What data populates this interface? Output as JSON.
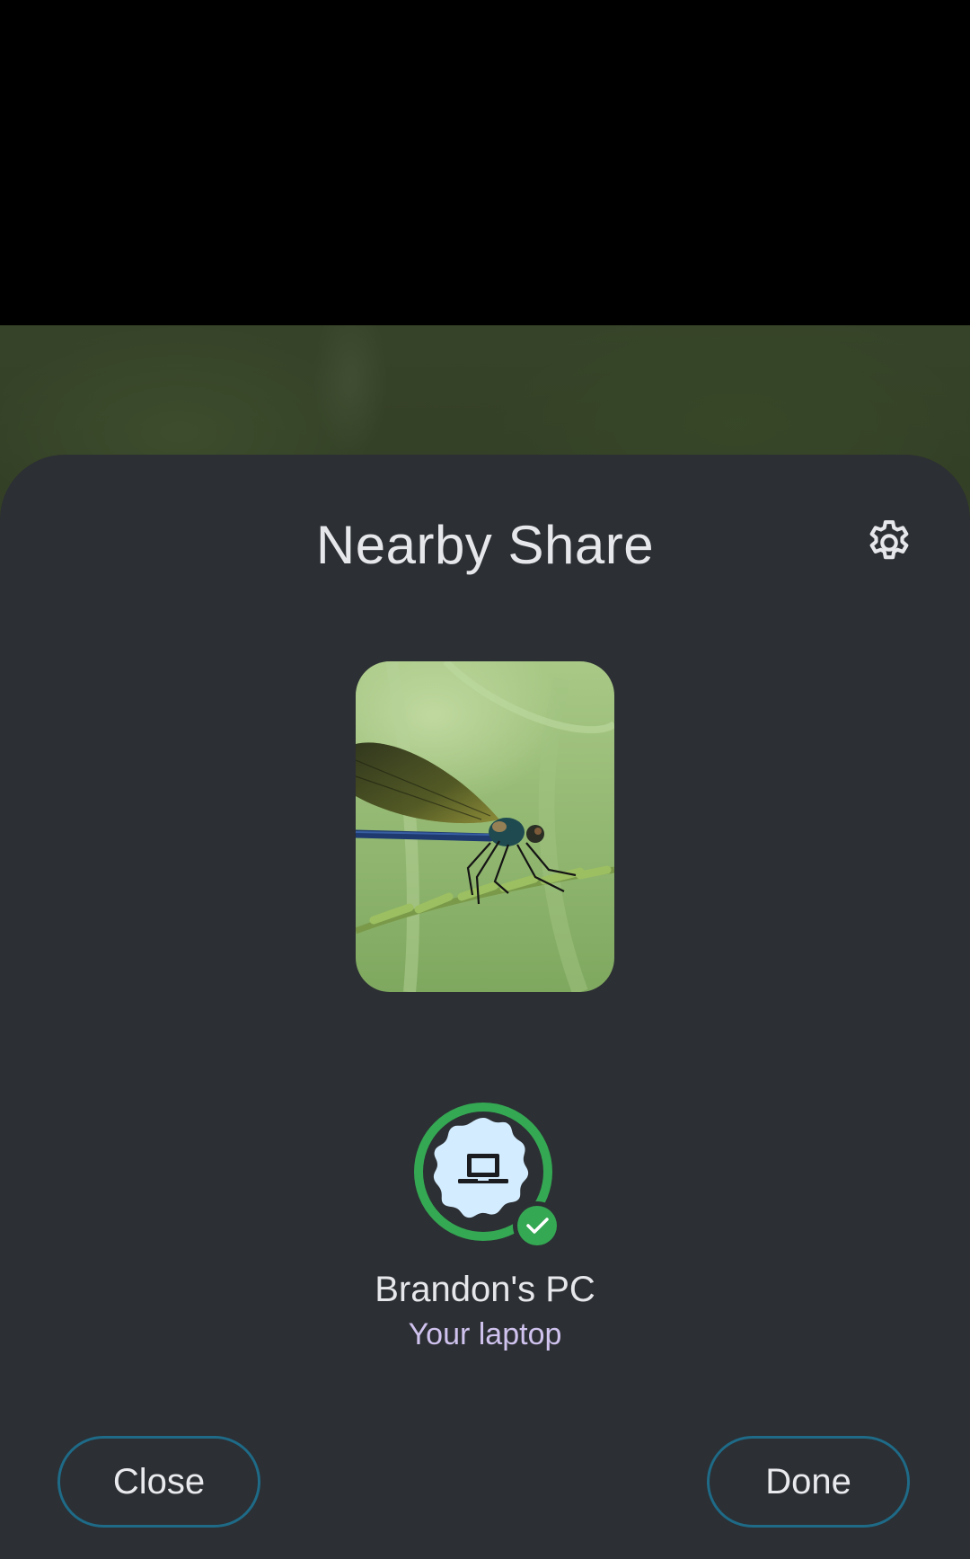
{
  "sheet": {
    "title": "Nearby Share",
    "settings_icon": "gear-icon"
  },
  "preview": {
    "subject": "dragonfly photo"
  },
  "device": {
    "name": "Brandon's PC",
    "subtitle": "Your laptop",
    "icon": "laptop-icon",
    "status_icon": "checkmark-icon",
    "status": "sent"
  },
  "actions": {
    "close_label": "Close",
    "done_label": "Done"
  },
  "colors": {
    "sheet_bg": "#2c2f33",
    "success_green": "#34a853",
    "device_bg": "#d3ecff",
    "button_border": "#1e6a87",
    "subtitle_color": "#cfc2ee"
  }
}
